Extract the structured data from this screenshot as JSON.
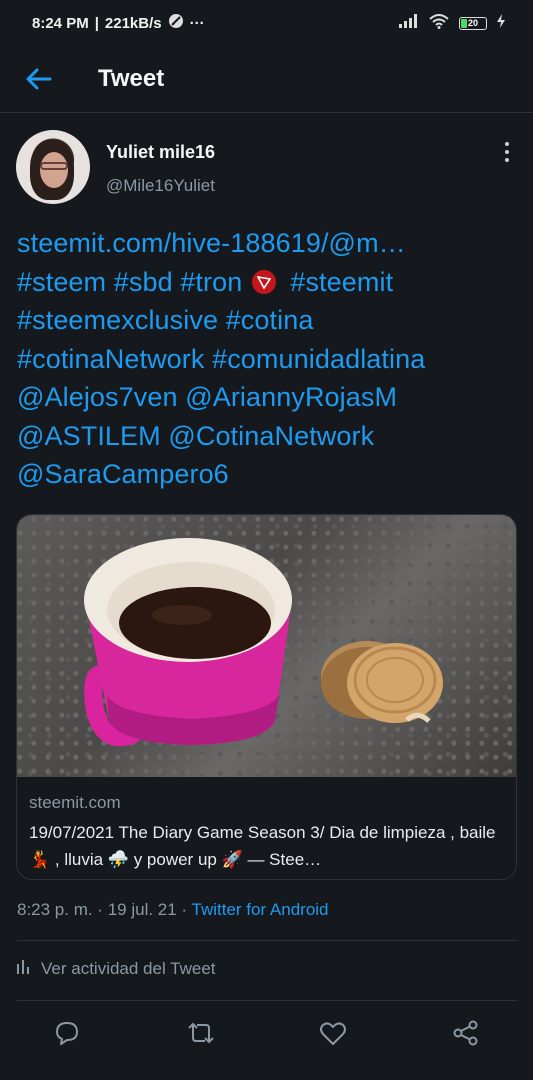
{
  "status_bar": {
    "time": "8:24 PM",
    "speed": "221kB/s",
    "more": "···",
    "battery": "20"
  },
  "header": {
    "title": "Tweet",
    "back_icon": "arrow-left-icon"
  },
  "author": {
    "name": "Yuliet mile16",
    "handle": "@Mile16Yuliet"
  },
  "tweet": {
    "link": "steemit.com/hive-188619/@m…",
    "line2a": "#steem #sbd #tron",
    "line2b": "#steemit",
    "line3": "#steemexclusive #cotina",
    "line4": "#cotinaNetwork #comunidadlatina",
    "line5": "@Alejos7ven @AriannyRojasM",
    "line6": "@ASTILEM @CotinaNetwork",
    "line7": "@SaraCampero6"
  },
  "card": {
    "domain": "steemit.com",
    "title": "19/07/2021 The Diary Game Season 3/ Dia de limpieza , baile 💃 , lluvia ⛈️ y power up 🚀 — Stee…"
  },
  "meta": {
    "time": "8:23 p. m. · 19 jul. 21 · ",
    "source": "Twitter for Android"
  },
  "activity": {
    "label": "Ver actividad del Tweet"
  },
  "colors": {
    "accent": "#1d9bf0",
    "background": "#15181c",
    "muted": "#8b98a5"
  }
}
